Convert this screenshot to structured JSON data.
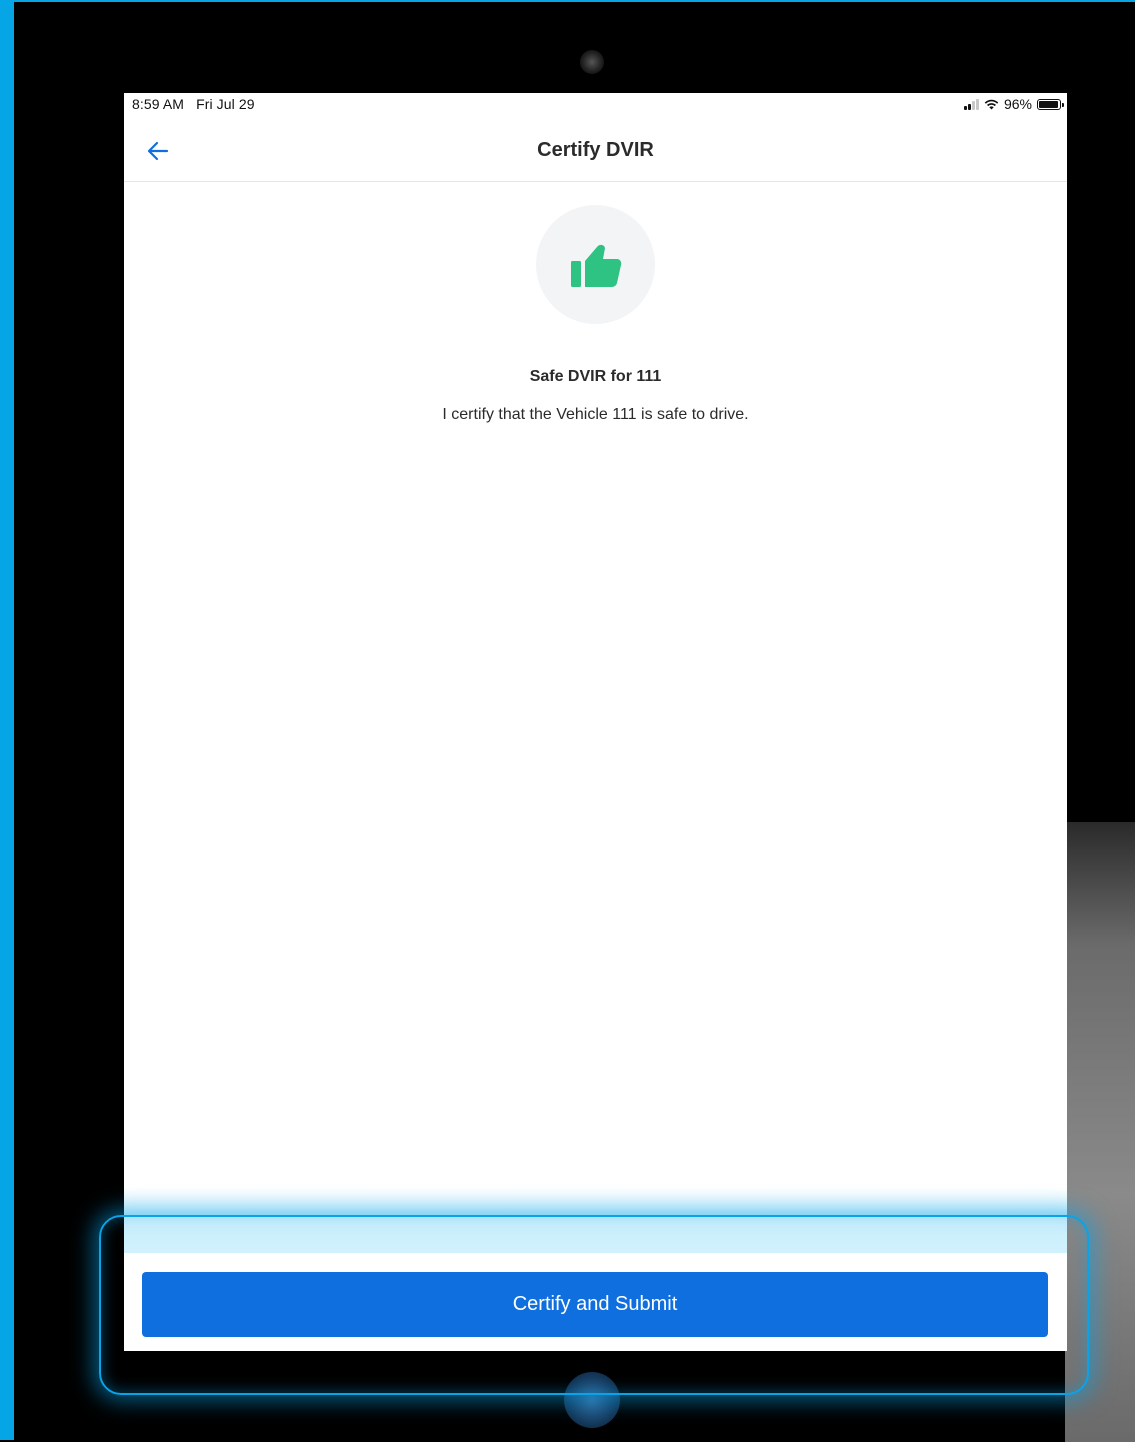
{
  "status_bar": {
    "time": "8:59 AM",
    "date": "Fri Jul 29",
    "battery_percent": "96%",
    "battery_level": 0.96
  },
  "nav": {
    "title": "Certify DVIR",
    "back_icon": "arrow-left-icon"
  },
  "content": {
    "icon": "thumbs-up-icon",
    "title": "Safe DVIR for 111",
    "description": "I certify that the Vehicle 111 is safe to drive."
  },
  "footer": {
    "submit_label": "Certify and Submit"
  },
  "colors": {
    "primary": "#0f6fde",
    "success": "#2ec283",
    "highlight": "#0aa3e8"
  }
}
